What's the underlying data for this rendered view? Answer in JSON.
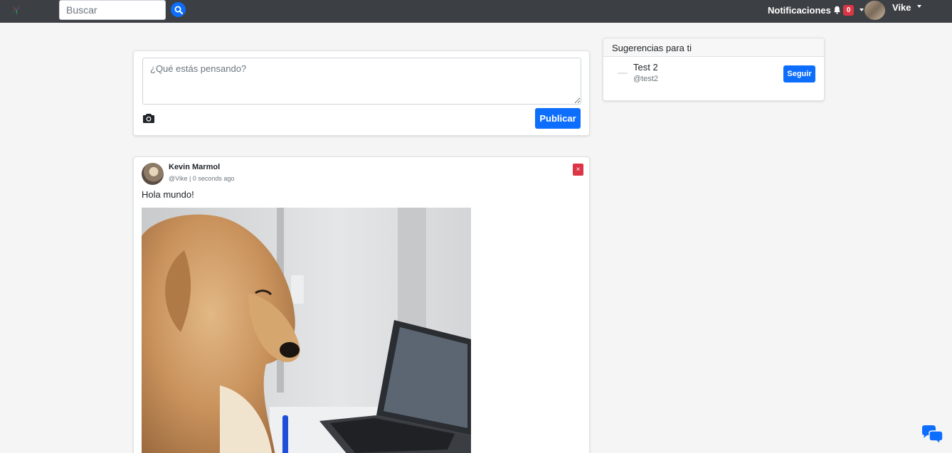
{
  "navbar": {
    "search_placeholder": "Buscar",
    "notifications_label": "Notificaciones",
    "notifications_count": "0",
    "user_name": "Vike"
  },
  "composer": {
    "placeholder": "¿Qué estás pensando?",
    "publish_label": "Publicar"
  },
  "suggestions": {
    "title": "Sugerencias para ti",
    "items": [
      {
        "name": "Test 2",
        "handle": "@test2",
        "follow_label": "Seguir"
      }
    ]
  },
  "post": {
    "author_name": "Kevin Marmol",
    "meta": "@Vike | 0 seconds ago",
    "delete_label": "×",
    "text": "Hola mundo!"
  },
  "colors": {
    "navbar": "#3c4044",
    "primary": "#0d6efd",
    "danger": "#dc3545",
    "background": "#f5f5f5"
  }
}
